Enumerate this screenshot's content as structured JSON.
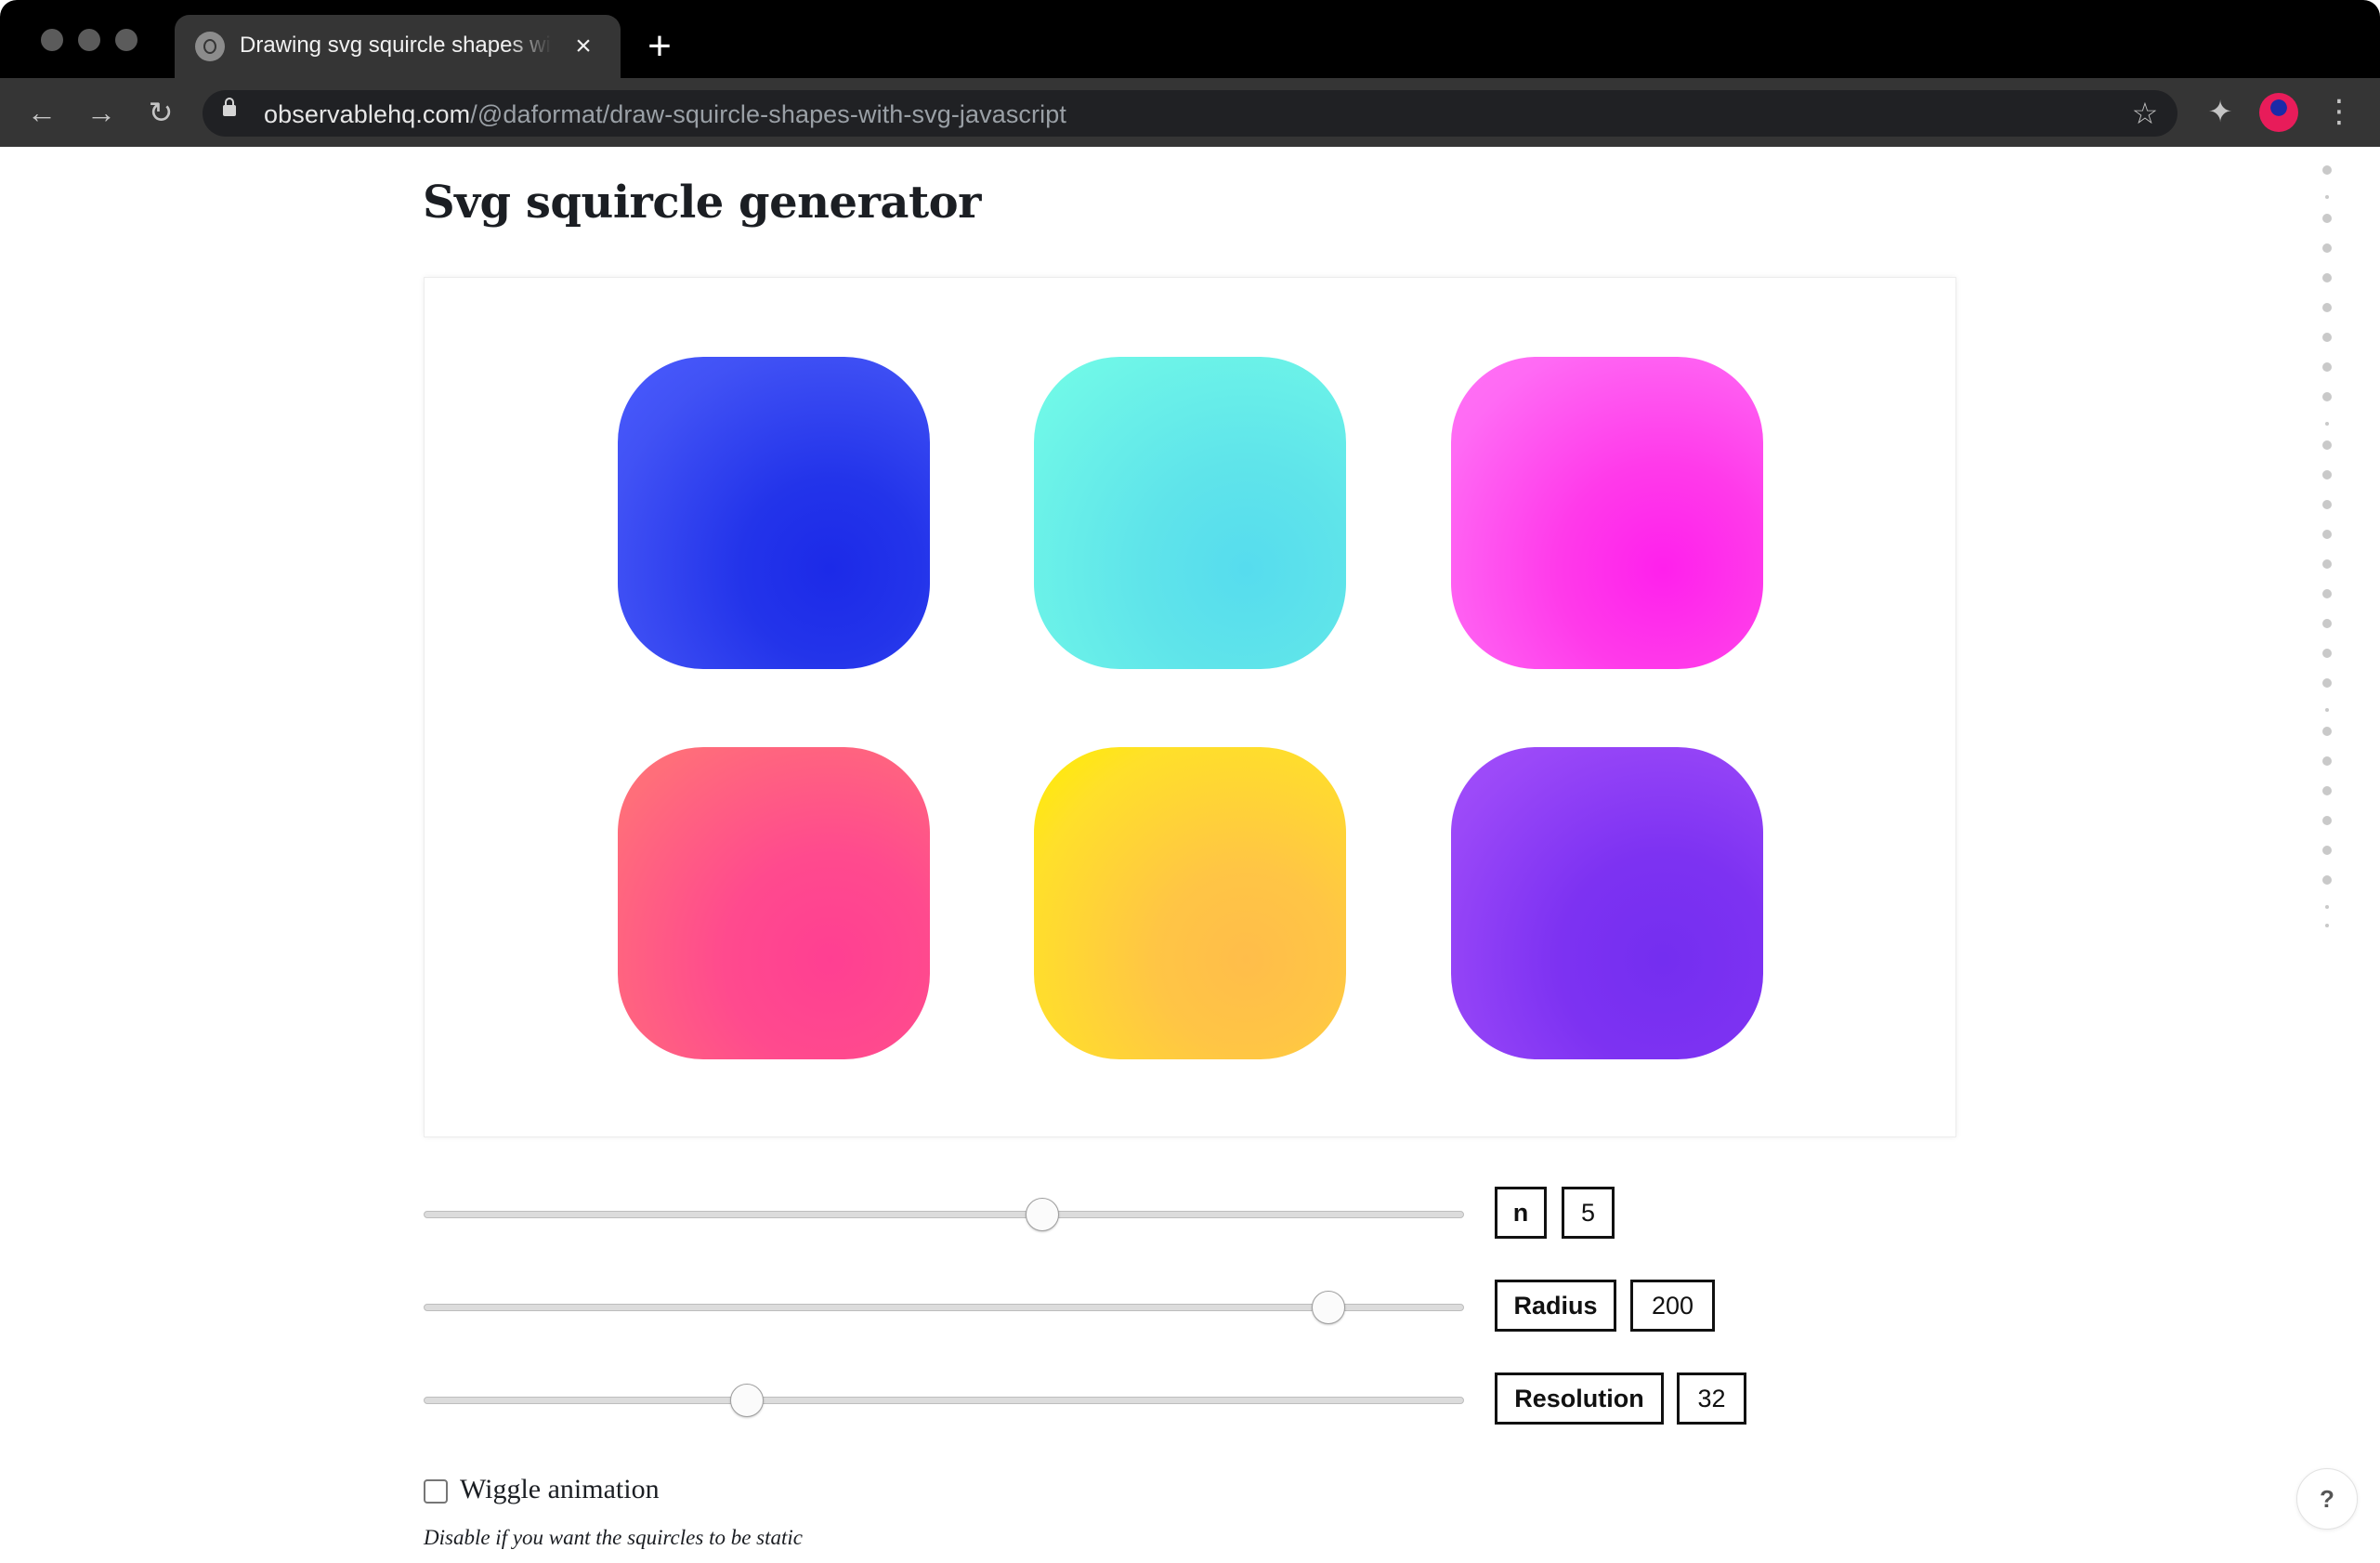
{
  "browser": {
    "tab_title": "Drawing svg squircle shapes with svg and javascript",
    "tab_close_icon": "×",
    "new_tab_icon": "+",
    "url_host": "observablehq.com",
    "url_path": "/@daformat/draw-squircle-shapes-with-svg-javascript",
    "back_icon": "←",
    "forward_icon": "→",
    "reload_icon": "↻",
    "star_icon": "☆",
    "extensions_icon": "✦",
    "menu_icon": "⋮"
  },
  "page": {
    "title": "Svg squircle generator",
    "squircles": [
      {
        "name": "blue",
        "color": "#2334ea"
      },
      {
        "name": "cyan",
        "color": "#5fe4ea"
      },
      {
        "name": "magenta",
        "color": "#ff3aea"
      },
      {
        "name": "coral",
        "color": "#ff4a8e"
      },
      {
        "name": "yellow",
        "color": "#ffc545"
      },
      {
        "name": "violet",
        "color": "#7d32f2"
      }
    ],
    "controls": {
      "n": {
        "label": "n",
        "value": "5",
        "fraction": 0.595
      },
      "radius": {
        "label": "Radius",
        "value": "200",
        "fraction": 0.87
      },
      "resolution": {
        "label": "Resolution",
        "value": "32",
        "fraction": 0.31
      }
    },
    "wiggle": {
      "label": "Wiggle animation",
      "checked": false,
      "note": "Disable if you want the squircles to be static"
    },
    "help_label": "?"
  }
}
